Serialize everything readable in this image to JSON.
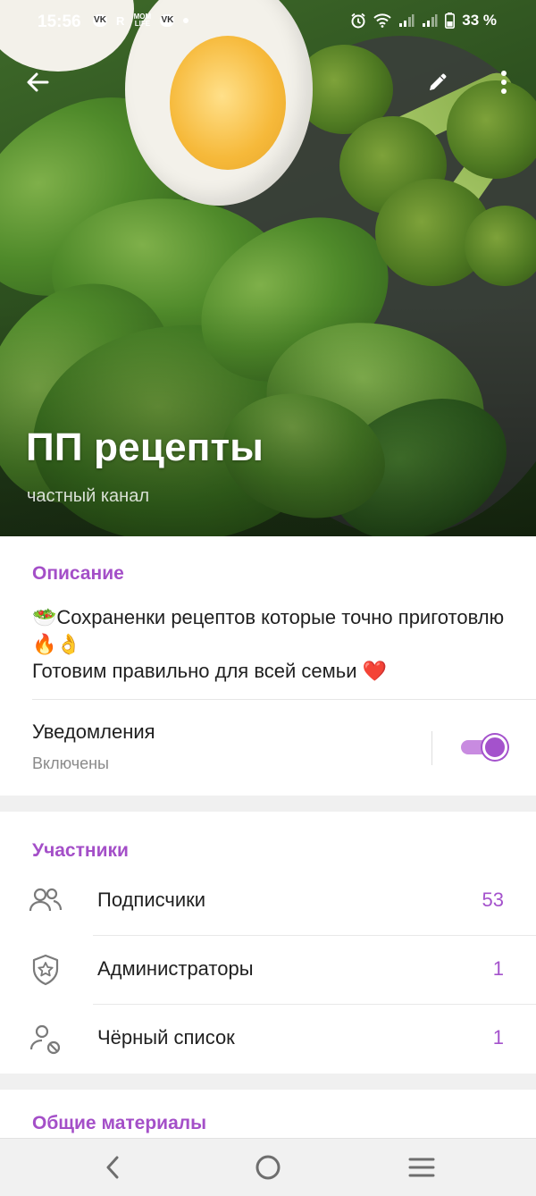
{
  "status_bar": {
    "time": "15:56",
    "app_badges": [
      "VK",
      "R",
      "MOM LIFE",
      "VK"
    ],
    "battery": "33 %"
  },
  "header": {
    "title": "ПП рецепты",
    "subtitle": "частный канал",
    "icons": [
      "arrow-left-icon",
      "pencil-icon",
      "more-vert-icon"
    ]
  },
  "description": {
    "section_title": "Описание",
    "line1": "Сохраненки рецептов которые точно приготовлю",
    "line2": "Готовим правильно для всей семьи",
    "emoji_salad": "🥗",
    "emoji_fire": "🔥",
    "emoji_ok": "👌",
    "emoji_heart": "❤️"
  },
  "notifications": {
    "label": "Уведомления",
    "status": "Включены",
    "enabled": true
  },
  "members": {
    "section_title": "Участники",
    "rows": [
      {
        "label": "Подписчики",
        "count": "53",
        "icon": "users-icon"
      },
      {
        "label": "Администраторы",
        "count": "1",
        "icon": "shield-star-icon"
      },
      {
        "label": "Чёрный список",
        "count": "1",
        "icon": "user-blocked-icon"
      }
    ]
  },
  "shared": {
    "section_title": "Общие материалы"
  },
  "colors": {
    "accent": "#a452cc",
    "section_title": "#a44fc8"
  }
}
